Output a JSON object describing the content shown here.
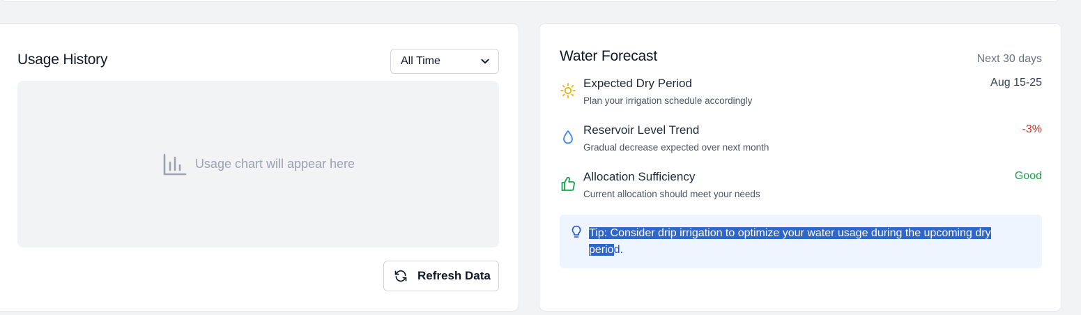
{
  "usage": {
    "title": "Usage History",
    "range_selected": "All Time",
    "placeholder": "Usage chart will appear here",
    "refresh_label": "Refresh Data"
  },
  "forecast": {
    "title": "Water Forecast",
    "period": "Next 30 days",
    "items": [
      {
        "name": "Expected Dry Period",
        "description": "Plan your irrigation schedule accordingly",
        "value": "Aug 15-25",
        "icon": "sun-icon",
        "value_color": "#374151"
      },
      {
        "name": "Reservoir Level Trend",
        "description": "Gradual decrease expected over next month",
        "value": "-3%",
        "icon": "water-drop-icon",
        "value_color": "#dc2626"
      },
      {
        "name": "Allocation Sufficiency",
        "description": "Current allocation should meet your needs",
        "value": "Good",
        "icon": "thumbs-up-icon",
        "value_color": "#16a34a"
      }
    ],
    "tip": {
      "selected_part1": "Tip: Consider drip irrigation to optimize your water usage during the upcoming dry",
      "selected_part2": "perio",
      "rest": "d.",
      "icon": "lightbulb-icon"
    }
  },
  "colors": {
    "accent_blue": "#1d4ed8",
    "tip_background": "#eef5ff",
    "selection": "#2f66c9"
  }
}
